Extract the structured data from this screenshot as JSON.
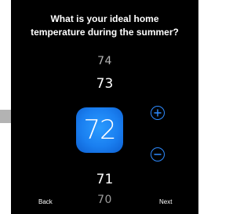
{
  "header": {
    "question_line1": "What is your ideal home",
    "question_line2": "temperature during the summer?"
  },
  "picker": {
    "values": [
      "74",
      "73",
      "72",
      "71",
      "70"
    ],
    "selected_value": "72",
    "accent_color": "#1a7ff0",
    "increase_icon": "plus-circle-icon",
    "decrease_icon": "minus-circle-icon"
  },
  "footer": {
    "back_label": "Back",
    "next_label": "Next"
  }
}
